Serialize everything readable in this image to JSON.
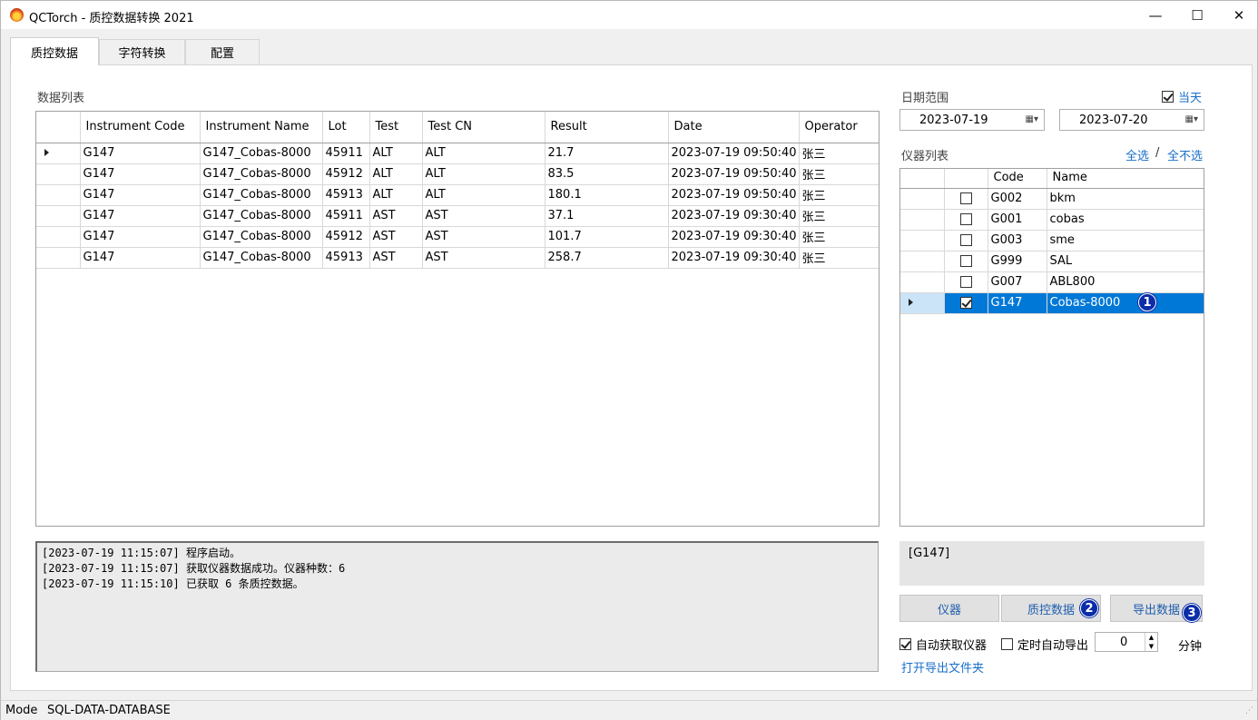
{
  "window": {
    "title": "QCTorch - 质控数据转换 2021",
    "minimize": "—",
    "maximize": "☐",
    "close": "✕"
  },
  "tabs": [
    "质控数据",
    "字符转换",
    "配置"
  ],
  "data_list": {
    "label": "数据列表",
    "columns": [
      "Instrument Code",
      "Instrument Name",
      "Lot",
      "Test",
      "Test CN",
      "Result",
      "Date",
      "Operator"
    ],
    "rows": [
      [
        "G147",
        "G147_Cobas-8000",
        "45911",
        "ALT",
        "ALT",
        "21.7",
        "2023-07-19 09:50:40",
        "张三"
      ],
      [
        "G147",
        "G147_Cobas-8000",
        "45912",
        "ALT",
        "ALT",
        "83.5",
        "2023-07-19 09:50:40",
        "张三"
      ],
      [
        "G147",
        "G147_Cobas-8000",
        "45913",
        "ALT",
        "ALT",
        "180.1",
        "2023-07-19 09:50:40",
        "张三"
      ],
      [
        "G147",
        "G147_Cobas-8000",
        "45911",
        "AST",
        "AST",
        "37.1",
        "2023-07-19 09:30:40",
        "张三"
      ],
      [
        "G147",
        "G147_Cobas-8000",
        "45912",
        "AST",
        "AST",
        "101.7",
        "2023-07-19 09:30:40",
        "张三"
      ],
      [
        "G147",
        "G147_Cobas-8000",
        "45913",
        "AST",
        "AST",
        "258.7",
        "2023-07-19 09:30:40",
        "张三"
      ]
    ]
  },
  "date_range": {
    "label": "日期范围",
    "today_label": "当天",
    "today_checked": true,
    "from": "2023-07-19",
    "to": "2023-07-20"
  },
  "instrument_list": {
    "label": "仪器列表",
    "select_all": "全选",
    "separator": "/",
    "select_none": "全不选",
    "columns": [
      "Code",
      "Name"
    ],
    "rows": [
      {
        "checked": false,
        "code": "G002",
        "name": "bkm"
      },
      {
        "checked": false,
        "code": "G001",
        "name": "cobas"
      },
      {
        "checked": false,
        "code": "G003",
        "name": "sme"
      },
      {
        "checked": false,
        "code": "G999",
        "name": "SAL"
      },
      {
        "checked": false,
        "code": "G007",
        "name": "ABL800"
      },
      {
        "checked": true,
        "code": "G147",
        "name": "Cobas-8000",
        "selected": true
      }
    ]
  },
  "log": [
    "[2023-07-19 11:15:07] 程序启动。",
    "[2023-07-19 11:15:07] 获取仪器数据成功。仪器种数：6",
    "[2023-07-19 11:15:10] 已获取 6 条质控数据。"
  ],
  "selected_instruments": "[G147]",
  "buttons": {
    "instrument": "仪器",
    "qc_data": "质控数据",
    "export": "导出数据"
  },
  "badges": [
    "1",
    "2",
    "3"
  ],
  "options": {
    "auto_fetch_label": "自动获取仪器",
    "auto_fetch_checked": true,
    "auto_export_label": "定时自动导出",
    "auto_export_checked": false,
    "interval_value": "0",
    "interval_unit": "分钟",
    "open_folder": "打开导出文件夹"
  },
  "status": {
    "mode_label": "Mode",
    "mode_value": "SQL-DATA-DATABASE"
  },
  "colors": {
    "selection": "#0078d7",
    "badge": "#0b2da8",
    "link": "#1a6fc9"
  }
}
